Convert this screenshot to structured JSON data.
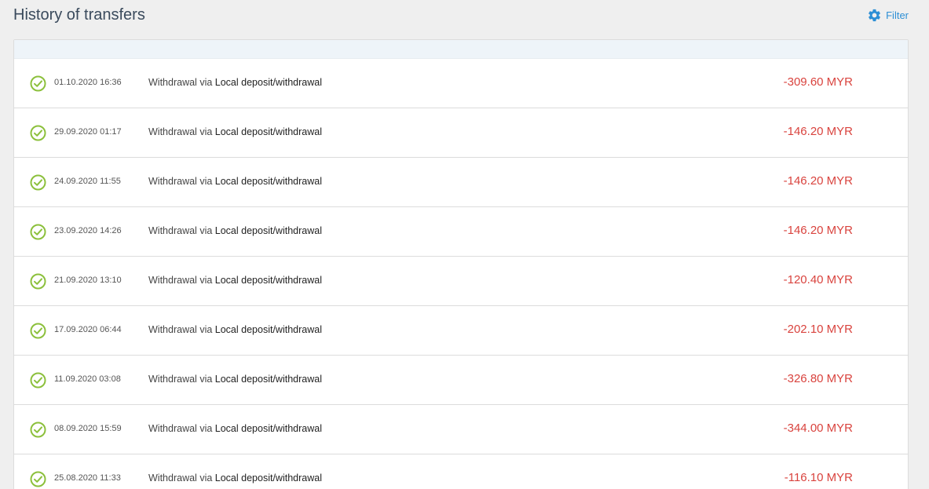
{
  "header": {
    "title": "History of transfers",
    "filter_label": "Filter",
    "filter_icon": "gear-icon"
  },
  "colors": {
    "accent": "#2d8fd5",
    "negative": "#d9433e",
    "success": "#8cc03c"
  },
  "transfers": [
    {
      "date": "01.10.2020 16:36",
      "type": "Withdrawal",
      "via": "via",
      "method": "Local deposit/withdrawal",
      "amount": "-309.60 MYR",
      "status": "check-circle-icon"
    },
    {
      "date": "29.09.2020 01:17",
      "type": "Withdrawal",
      "via": "via",
      "method": "Local deposit/withdrawal",
      "amount": "-146.20 MYR",
      "status": "check-circle-icon"
    },
    {
      "date": "24.09.2020 11:55",
      "type": "Withdrawal",
      "via": "via",
      "method": "Local deposit/withdrawal",
      "amount": "-146.20 MYR",
      "status": "check-circle-icon"
    },
    {
      "date": "23.09.2020 14:26",
      "type": "Withdrawal",
      "via": "via",
      "method": "Local deposit/withdrawal",
      "amount": "-146.20 MYR",
      "status": "check-circle-icon"
    },
    {
      "date": "21.09.2020 13:10",
      "type": "Withdrawal",
      "via": "via",
      "method": "Local deposit/withdrawal",
      "amount": "-120.40 MYR",
      "status": "check-circle-icon"
    },
    {
      "date": "17.09.2020 06:44",
      "type": "Withdrawal",
      "via": "via",
      "method": "Local deposit/withdrawal",
      "amount": "-202.10 MYR",
      "status": "check-circle-icon"
    },
    {
      "date": "11.09.2020 03:08",
      "type": "Withdrawal",
      "via": "via",
      "method": "Local deposit/withdrawal",
      "amount": "-326.80 MYR",
      "status": "check-circle-icon"
    },
    {
      "date": "08.09.2020 15:59",
      "type": "Withdrawal",
      "via": "via",
      "method": "Local deposit/withdrawal",
      "amount": "-344.00 MYR",
      "status": "check-circle-icon"
    },
    {
      "date": "25.08.2020 11:33",
      "type": "Withdrawal",
      "via": "via",
      "method": "Local deposit/withdrawal",
      "amount": "-116.10 MYR",
      "status": "check-circle-icon"
    }
  ]
}
